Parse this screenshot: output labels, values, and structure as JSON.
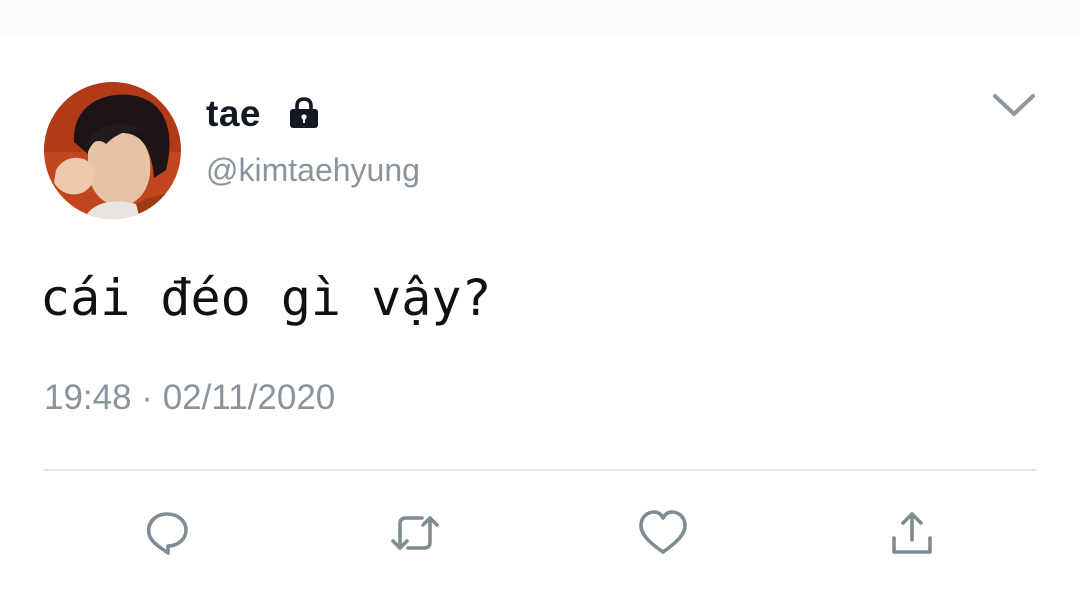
{
  "tweet": {
    "author": {
      "display_name": "tae",
      "handle": "@kimtaehyung",
      "protected_icon": "lock-icon"
    },
    "text": "cái đéo gì vậy?",
    "timestamp": "19:48 · 02/11/2020",
    "menu_icon": "chevron-down-icon",
    "actions": [
      {
        "name": "reply",
        "icon": "speech-bubble-icon"
      },
      {
        "name": "retweet",
        "icon": "retweet-arrows-icon"
      },
      {
        "name": "like",
        "icon": "heart-icon"
      },
      {
        "name": "share",
        "icon": "share-upload-icon"
      }
    ]
  },
  "colors": {
    "text_primary": "#141823",
    "text_secondary": "#8a949c",
    "icon": "#7f8c93",
    "divider": "#e3e7ea",
    "avatar_background": "#c2451d"
  }
}
